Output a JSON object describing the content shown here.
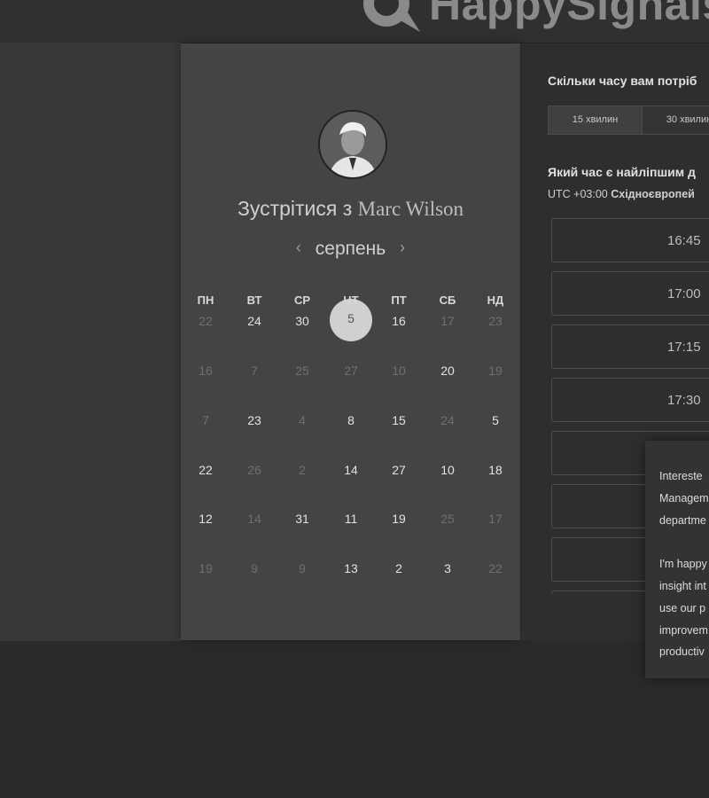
{
  "brand": {
    "logo_text": "HappySignals"
  },
  "card": {
    "title_prefix": "Зустрітися з",
    "host_name": "Marc Wilson",
    "month": "серпень",
    "prev_icon": "chevron-left-icon",
    "next_icon": "chevron-right-icon",
    "weekdays": [
      "ПН",
      "ВТ",
      "СР",
      "ЧТ",
      "ПТ",
      "СБ",
      "НД"
    ],
    "weeks": [
      [
        {
          "d": "22",
          "dim": true
        },
        {
          "d": "24",
          "dim": false
        },
        {
          "d": "30",
          "dim": false
        },
        {
          "d": "5",
          "dim": false,
          "selected": true
        },
        {
          "d": "16",
          "dim": false
        },
        {
          "d": "17",
          "dim": true
        },
        {
          "d": "23",
          "dim": true
        }
      ],
      [
        {
          "d": "16",
          "dim": true
        },
        {
          "d": "7",
          "dim": true
        },
        {
          "d": "25",
          "dim": true
        },
        {
          "d": "27",
          "dim": true
        },
        {
          "d": "10",
          "dim": true
        },
        {
          "d": "20",
          "dim": false
        },
        {
          "d": "19",
          "dim": true
        }
      ],
      [
        {
          "d": "7",
          "dim": true
        },
        {
          "d": "23",
          "dim": false
        },
        {
          "d": "4",
          "dim": true
        },
        {
          "d": "8",
          "dim": false
        },
        {
          "d": "15",
          "dim": false
        },
        {
          "d": "24",
          "dim": true
        },
        {
          "d": "5",
          "dim": false
        }
      ],
      [
        {
          "d": "22",
          "dim": false
        },
        {
          "d": "26",
          "dim": true
        },
        {
          "d": "2",
          "dim": true
        },
        {
          "d": "14",
          "dim": false
        },
        {
          "d": "27",
          "dim": false
        },
        {
          "d": "10",
          "dim": false
        },
        {
          "d": "18",
          "dim": false
        }
      ],
      [
        {
          "d": "12",
          "dim": false
        },
        {
          "d": "14",
          "dim": true
        },
        {
          "d": "31",
          "dim": false
        },
        {
          "d": "11",
          "dim": false
        },
        {
          "d": "19",
          "dim": false
        },
        {
          "d": "25",
          "dim": true
        },
        {
          "d": "17",
          "dim": true
        }
      ],
      [
        {
          "d": "19",
          "dim": true
        },
        {
          "d": "9",
          "dim": true
        },
        {
          "d": "9",
          "dim": true
        },
        {
          "d": "13",
          "dim": false
        },
        {
          "d": "2",
          "dim": false
        },
        {
          "d": "3",
          "dim": false
        },
        {
          "d": "22",
          "dim": true
        }
      ]
    ]
  },
  "scheduler": {
    "duration_question": "Скільки часу вам потріб",
    "durations": [
      {
        "label": "15 хвилин",
        "active": true
      },
      {
        "label": "30 хвилин",
        "active": false
      }
    ],
    "time_question": "Який час є найліпшим д",
    "timezone_offset": "UTC +03:00",
    "timezone_name": "Східноєвропей",
    "slots": [
      "16:45",
      "17:00",
      "17:15",
      "17:30",
      "",
      "",
      "",
      ""
    ]
  },
  "popup": {
    "lines": [
      "Intereste",
      "Managem",
      "departme",
      "",
      "I'm happy",
      "insight int",
      "use our p",
      "improvem",
      "productiv"
    ]
  },
  "colors": {
    "background": "#2b2b2b",
    "card": "#444444",
    "selected_day": "#d0d0d0",
    "panel": "#2e2e2e"
  }
}
